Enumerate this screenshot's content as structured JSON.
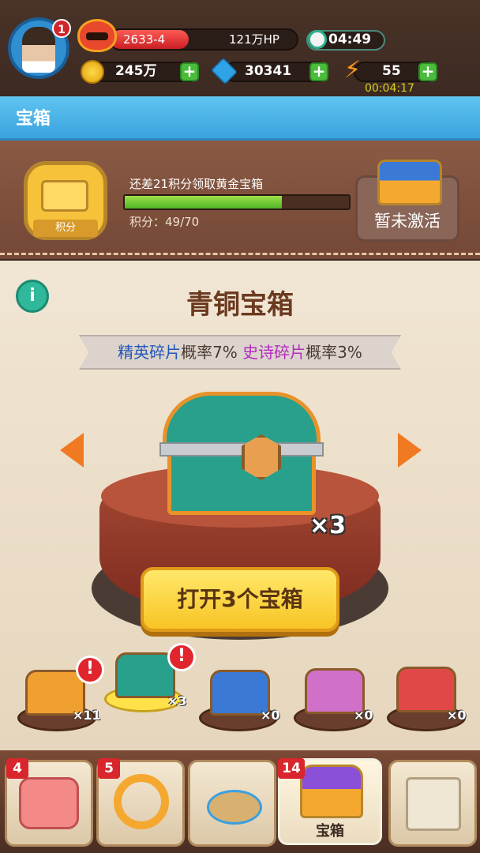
{
  "hud": {
    "avatar_level": "1",
    "stage": "2633-4",
    "hp_text": "121万HP",
    "hp_fill_fraction": 0.42,
    "timer": "04:49",
    "coins": "245万",
    "gems": "30341",
    "energy": "55",
    "energy_timer": "00:04:17",
    "plus_label": "+"
  },
  "titlebar": {
    "title": "宝箱"
  },
  "score_panel": {
    "medal_label": "积分",
    "hint": "还差21积分领取黄金宝箱",
    "progress_text": "积分：49/70",
    "progress_value": 49,
    "progress_max": 70,
    "inactive_label": "暂未激活"
  },
  "chest_view": {
    "info_label": "i",
    "title": "青铜宝箱",
    "rate_elite_label": "精英碎片",
    "rate_elite_value": "概率7%",
    "rate_epic_label": "史诗碎片",
    "rate_epic_value": "概率3%",
    "count": "×3",
    "open_button": "打开3个宝箱"
  },
  "chest_slots": [
    {
      "count": "×11",
      "color": "#f0a030",
      "alert": "!"
    },
    {
      "count": "×3",
      "color": "#28a08c",
      "alert": "!"
    },
    {
      "count": "×0",
      "color": "#3a7ad6",
      "alert": ""
    },
    {
      "count": "×0",
      "color": "#d070c8",
      "alert": ""
    },
    {
      "count": "×0",
      "color": "#e04848",
      "alert": ""
    }
  ],
  "bottom_nav": {
    "tabs": [
      {
        "badge": "4",
        "icon": "cat-icon"
      },
      {
        "badge": "5",
        "icon": "ring-icon"
      },
      {
        "badge": "",
        "icon": "island-icon"
      },
      {
        "badge": "14",
        "icon": "chest-icon",
        "label": "宝箱"
      },
      {
        "badge": "",
        "icon": "scroll-icon"
      }
    ]
  },
  "colors": {
    "accent": "#3aa3de",
    "open_button": "#f8c424",
    "progress": "#4fb426"
  }
}
